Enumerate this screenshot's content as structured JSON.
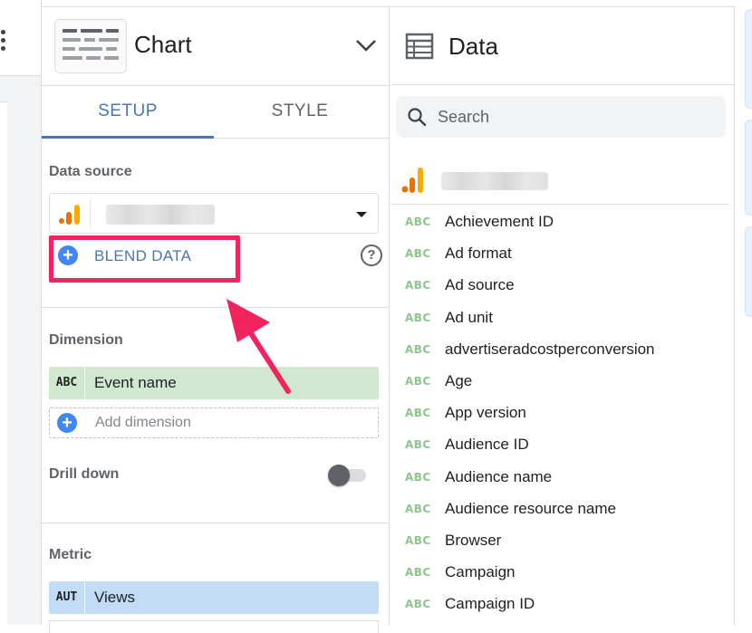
{
  "chart_panel": {
    "title": "Chart",
    "tabs": [
      {
        "label": "SETUP",
        "active": true
      },
      {
        "label": "STYLE",
        "active": false
      }
    ],
    "data_source": {
      "label": "Data source",
      "selected_value": "",
      "blend_label": "BLEND DATA",
      "help_glyph": "?"
    },
    "dimension": {
      "label": "Dimension",
      "chip_type": "ABC",
      "chip_name": "Event name",
      "add_label": "Add dimension"
    },
    "drill_down": {
      "label": "Drill down",
      "enabled": false
    },
    "metric": {
      "label": "Metric",
      "chip_type": "AUT",
      "chip_name": "Views"
    }
  },
  "data_panel": {
    "title": "Data",
    "search": {
      "placeholder": "Search",
      "value": ""
    },
    "field_type": "ABC",
    "fields": [
      "Achievement ID",
      "Ad format",
      "Ad source",
      "Ad unit",
      "advertiseradcostperconversion",
      "Age",
      "App version",
      "Audience ID",
      "Audience name",
      "Audience resource name",
      "Browser",
      "Campaign",
      "Campaign ID"
    ]
  },
  "icons": {
    "menu": "kebab-menu-icon",
    "chart_type": "table-chart-icon",
    "expand": "chevron-down-icon",
    "analytics": "google-analytics-icon",
    "add": "plus-circle-icon",
    "help": "help-circle-icon",
    "data": "table-icon",
    "search": "search-icon",
    "annotation": "arrow-annotation"
  },
  "colors": {
    "accent": "#4a76b8",
    "highlight": "#f0245f",
    "dimension_chip": "#cfe8cf",
    "metric_chip": "#c2dcf6",
    "field_type": "#8ec58e",
    "analytics_orange": "#f9ab00",
    "analytics_dark": "#e37400"
  }
}
